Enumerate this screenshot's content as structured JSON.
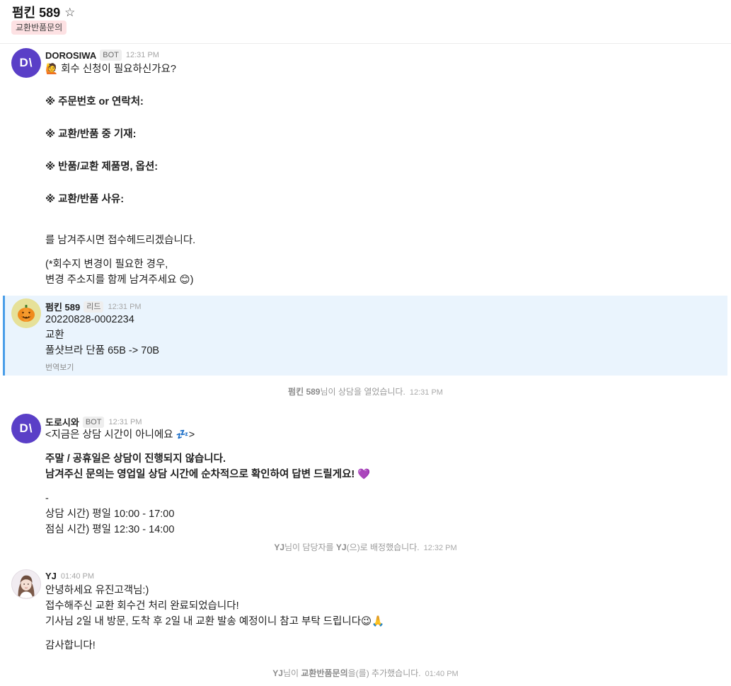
{
  "header": {
    "title": "펌킨 589",
    "star_icon": "star-outline-icon",
    "tag": "교환반품문의",
    "tag_color": "#fde1e3"
  },
  "messages": [
    {
      "sender": "DOROSIWA",
      "badge": "BOT",
      "time": "12:31 PM",
      "avatar_text": "D\\",
      "avatar_color": "#5a3fc7",
      "lines": [
        "🙋 회수 신청이 필요하신가요?",
        "※ 주문번호 or 연락처:",
        "※ 교환/반품 중 기재:",
        "※ 반품/교환 제품명, 옵션:",
        "※ 교환/반품 사유:",
        "를 남겨주시면 접수헤드리겠습니다.",
        "(*회수지 변경이 필요한 경우,",
        "변경 주소지를 함께 남겨주세요 😊)"
      ]
    },
    {
      "sender": "펌킨 589",
      "badge": "리드",
      "time": "12:31 PM",
      "avatar_icon": "jack-o-lantern-icon",
      "lines": [
        "20220828-0002234",
        "교환",
        "풀샷브라 단품 65B -> 70B"
      ],
      "translate_label": "번역보기"
    },
    {
      "sender": "도로시와",
      "badge": "BOT",
      "time": "12:31 PM",
      "avatar_text": "D\\",
      "lines": [
        "<지금은 상담 시간이 아니에요 💤>",
        "주말 / 공휴일은 상담이 진행되지 않습니다.",
        "남겨주신 문의는 영업일 상담 시간에 순차적으로 확인하여 답변 드릴게요! 💜",
        "-",
        "상담 시간) 평일 10:00 - 17:00",
        "점심 시간) 평일 12:30 - 14:00"
      ]
    },
    {
      "sender": "YJ",
      "time": "01:40 PM",
      "avatar_icon": "user-portrait-icon",
      "lines": [
        "안녕하세요 유진고객님:)",
        "접수해주신 교환 회수건 처리 완료되었습니다!",
        "기사님 2일 내 방문, 도착 후 2일 내 교환 발송 예정이니 참고 부탁 드립니다😉🙏",
        "감사합니다!"
      ]
    }
  ],
  "system_events": [
    {
      "bold": "펌킨 589",
      "text": "님이 상담을 열었습니다.",
      "time": "12:31 PM"
    },
    {
      "bold": "YJ",
      "text": "님이 담당자를 ",
      "bold2": "YJ",
      "text2": "(으)로 배정했습니다.",
      "time": "12:32 PM"
    },
    {
      "bold": "YJ",
      "text": "님이 ",
      "bold2": "교환반품문의",
      "text2": "을(를) 추가했습니다.",
      "time": "01:40 PM"
    }
  ]
}
